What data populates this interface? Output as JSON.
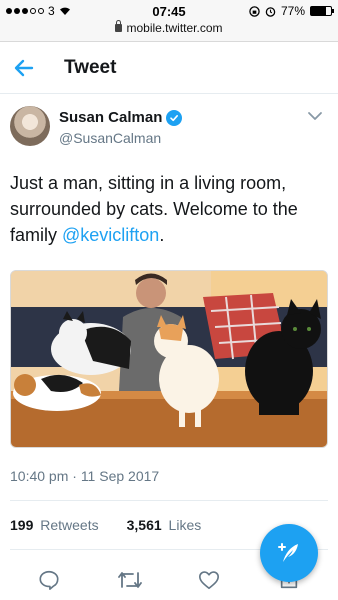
{
  "status_bar": {
    "carrier": "3",
    "time": "07:45",
    "battery": "77%",
    "battery_level": 0.77,
    "url": "mobile.twitter.com"
  },
  "header": {
    "title": "Tweet"
  },
  "tweet": {
    "author_name": "Susan Calman",
    "author_handle": "@SusanCalman",
    "text_main": "Just a man, sitting in a living room, surrounded by cats. Welcome to the family ",
    "mention": "@keviclifton",
    "text_end": ".",
    "timestamp": "10:40 pm · 11 Sep 2017",
    "retweets_count": "199",
    "retweets_label": "Retweets",
    "likes_count": "3,561",
    "likes_label": "Likes"
  },
  "icons": {
    "back": "back-arrow-icon",
    "verified": "verified-badge-icon",
    "chevron": "chevron-down-icon",
    "reply": "reply-icon",
    "retweet": "retweet-icon",
    "like": "heart-icon",
    "share": "share-icon",
    "compose": "compose-tweet-icon"
  },
  "colors": {
    "accent": "#1da1f2",
    "text": "#14171a",
    "secondary": "#657786"
  }
}
